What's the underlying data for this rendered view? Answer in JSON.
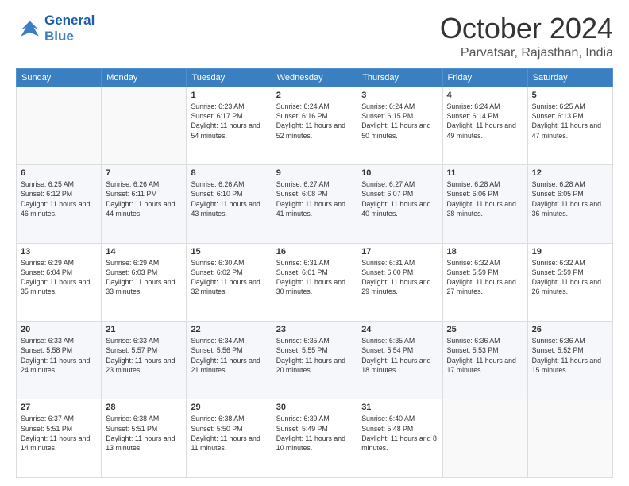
{
  "logo": {
    "line1": "General",
    "line2": "Blue"
  },
  "header": {
    "month": "October 2024",
    "location": "Parvatsar, Rajasthan, India"
  },
  "weekdays": [
    "Sunday",
    "Monday",
    "Tuesday",
    "Wednesday",
    "Thursday",
    "Friday",
    "Saturday"
  ],
  "weeks": [
    [
      {
        "day": "",
        "info": ""
      },
      {
        "day": "",
        "info": ""
      },
      {
        "day": "1",
        "info": "Sunrise: 6:23 AM\nSunset: 6:17 PM\nDaylight: 11 hours and 54 minutes."
      },
      {
        "day": "2",
        "info": "Sunrise: 6:24 AM\nSunset: 6:16 PM\nDaylight: 11 hours and 52 minutes."
      },
      {
        "day": "3",
        "info": "Sunrise: 6:24 AM\nSunset: 6:15 PM\nDaylight: 11 hours and 50 minutes."
      },
      {
        "day": "4",
        "info": "Sunrise: 6:24 AM\nSunset: 6:14 PM\nDaylight: 11 hours and 49 minutes."
      },
      {
        "day": "5",
        "info": "Sunrise: 6:25 AM\nSunset: 6:13 PM\nDaylight: 11 hours and 47 minutes."
      }
    ],
    [
      {
        "day": "6",
        "info": "Sunrise: 6:25 AM\nSunset: 6:12 PM\nDaylight: 11 hours and 46 minutes."
      },
      {
        "day": "7",
        "info": "Sunrise: 6:26 AM\nSunset: 6:11 PM\nDaylight: 11 hours and 44 minutes."
      },
      {
        "day": "8",
        "info": "Sunrise: 6:26 AM\nSunset: 6:10 PM\nDaylight: 11 hours and 43 minutes."
      },
      {
        "day": "9",
        "info": "Sunrise: 6:27 AM\nSunset: 6:08 PM\nDaylight: 11 hours and 41 minutes."
      },
      {
        "day": "10",
        "info": "Sunrise: 6:27 AM\nSunset: 6:07 PM\nDaylight: 11 hours and 40 minutes."
      },
      {
        "day": "11",
        "info": "Sunrise: 6:28 AM\nSunset: 6:06 PM\nDaylight: 11 hours and 38 minutes."
      },
      {
        "day": "12",
        "info": "Sunrise: 6:28 AM\nSunset: 6:05 PM\nDaylight: 11 hours and 36 minutes."
      }
    ],
    [
      {
        "day": "13",
        "info": "Sunrise: 6:29 AM\nSunset: 6:04 PM\nDaylight: 11 hours and 35 minutes."
      },
      {
        "day": "14",
        "info": "Sunrise: 6:29 AM\nSunset: 6:03 PM\nDaylight: 11 hours and 33 minutes."
      },
      {
        "day": "15",
        "info": "Sunrise: 6:30 AM\nSunset: 6:02 PM\nDaylight: 11 hours and 32 minutes."
      },
      {
        "day": "16",
        "info": "Sunrise: 6:31 AM\nSunset: 6:01 PM\nDaylight: 11 hours and 30 minutes."
      },
      {
        "day": "17",
        "info": "Sunrise: 6:31 AM\nSunset: 6:00 PM\nDaylight: 11 hours and 29 minutes."
      },
      {
        "day": "18",
        "info": "Sunrise: 6:32 AM\nSunset: 5:59 PM\nDaylight: 11 hours and 27 minutes."
      },
      {
        "day": "19",
        "info": "Sunrise: 6:32 AM\nSunset: 5:59 PM\nDaylight: 11 hours and 26 minutes."
      }
    ],
    [
      {
        "day": "20",
        "info": "Sunrise: 6:33 AM\nSunset: 5:58 PM\nDaylight: 11 hours and 24 minutes."
      },
      {
        "day": "21",
        "info": "Sunrise: 6:33 AM\nSunset: 5:57 PM\nDaylight: 11 hours and 23 minutes."
      },
      {
        "day": "22",
        "info": "Sunrise: 6:34 AM\nSunset: 5:56 PM\nDaylight: 11 hours and 21 minutes."
      },
      {
        "day": "23",
        "info": "Sunrise: 6:35 AM\nSunset: 5:55 PM\nDaylight: 11 hours and 20 minutes."
      },
      {
        "day": "24",
        "info": "Sunrise: 6:35 AM\nSunset: 5:54 PM\nDaylight: 11 hours and 18 minutes."
      },
      {
        "day": "25",
        "info": "Sunrise: 6:36 AM\nSunset: 5:53 PM\nDaylight: 11 hours and 17 minutes."
      },
      {
        "day": "26",
        "info": "Sunrise: 6:36 AM\nSunset: 5:52 PM\nDaylight: 11 hours and 15 minutes."
      }
    ],
    [
      {
        "day": "27",
        "info": "Sunrise: 6:37 AM\nSunset: 5:51 PM\nDaylight: 11 hours and 14 minutes."
      },
      {
        "day": "28",
        "info": "Sunrise: 6:38 AM\nSunset: 5:51 PM\nDaylight: 11 hours and 13 minutes."
      },
      {
        "day": "29",
        "info": "Sunrise: 6:38 AM\nSunset: 5:50 PM\nDaylight: 11 hours and 11 minutes."
      },
      {
        "day": "30",
        "info": "Sunrise: 6:39 AM\nSunset: 5:49 PM\nDaylight: 11 hours and 10 minutes."
      },
      {
        "day": "31",
        "info": "Sunrise: 6:40 AM\nSunset: 5:48 PM\nDaylight: 11 hours and 8 minutes."
      },
      {
        "day": "",
        "info": ""
      },
      {
        "day": "",
        "info": ""
      }
    ]
  ]
}
